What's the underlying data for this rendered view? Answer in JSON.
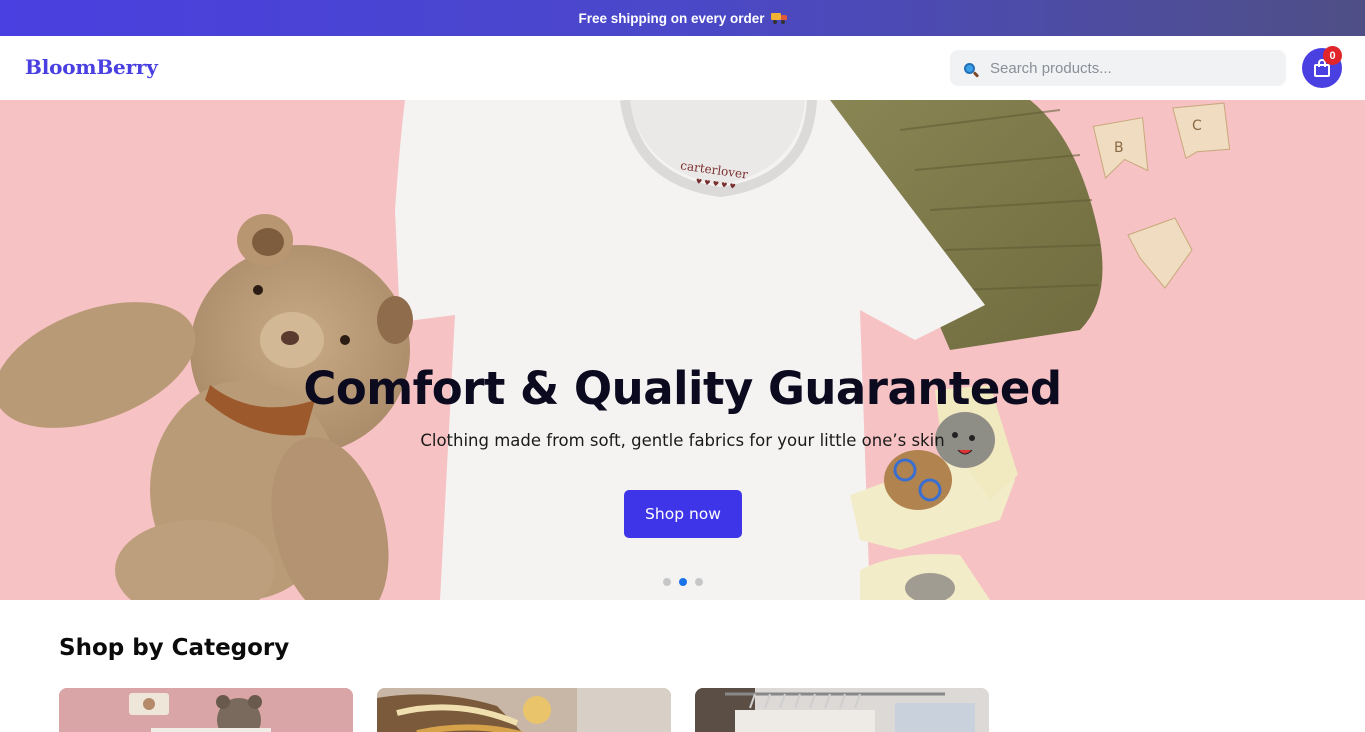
{
  "announcement": {
    "text": "Free shipping on every order",
    "icon": "truck-icon"
  },
  "header": {
    "logo": "BloomBerry",
    "search": {
      "placeholder": "Search products...",
      "value": ""
    },
    "cart": {
      "count": "0",
      "icon": "shopping-bag-icon"
    }
  },
  "hero": {
    "title": "Comfort & Quality Guaranteed",
    "subtitle": "Clothing made from soft, gentle fabrics for your little one’s skin",
    "button_label": "Shop now",
    "slides_total": 3,
    "active_slide": 2,
    "shirt_tag": "carterlover"
  },
  "categories": {
    "heading": "Shop by Category"
  },
  "colors": {
    "brand": "#4a3fe0",
    "badge": "#e0262b",
    "hero_bg": "#f6c2c3",
    "active_dot": "#1a73e8"
  }
}
